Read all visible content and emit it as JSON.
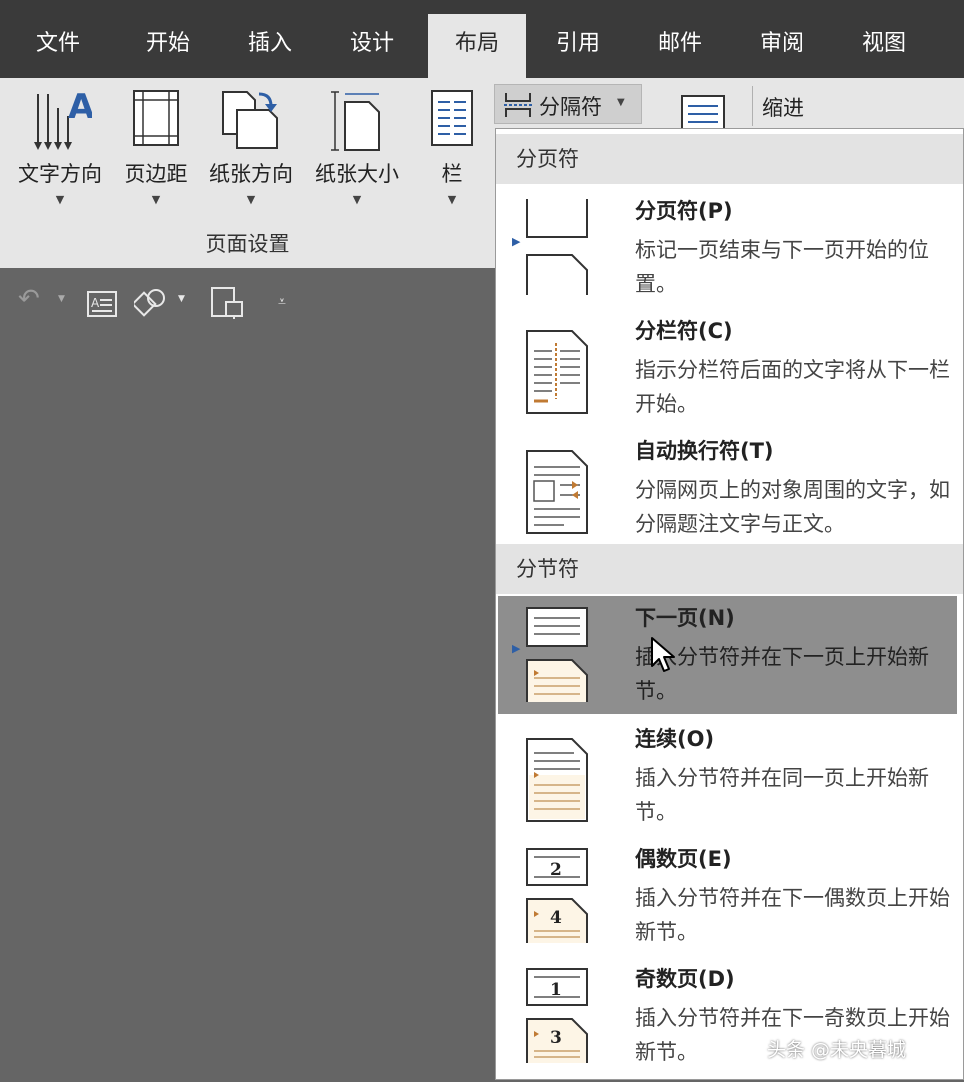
{
  "tabs": [
    {
      "label": "文件",
      "active": false
    },
    {
      "label": "开始",
      "active": false
    },
    {
      "label": "插入",
      "active": false
    },
    {
      "label": "设计",
      "active": false
    },
    {
      "label": "布局",
      "active": true
    },
    {
      "label": "引用",
      "active": false
    },
    {
      "label": "邮件",
      "active": false
    },
    {
      "label": "审阅",
      "active": false
    },
    {
      "label": "视图",
      "active": false
    }
  ],
  "ribbon": {
    "buttons": [
      {
        "label": "文字方向",
        "icon": "text-direction-icon"
      },
      {
        "label": "页边距",
        "icon": "margins-icon"
      },
      {
        "label": "纸张方向",
        "icon": "orientation-icon"
      },
      {
        "label": "纸张大小",
        "icon": "paper-size-icon"
      },
      {
        "label": "栏",
        "icon": "columns-icon"
      }
    ],
    "group_label": "页面设置",
    "breaks_button": "分隔符",
    "indent_label": "缩进"
  },
  "qat": [
    "undo-icon",
    "text-box-icon",
    "shapes-icon",
    "touch-mode-icon",
    "customize-icon"
  ],
  "menu": {
    "section1": "分页符",
    "section2": "分节符",
    "items": [
      {
        "title": "分页符(P)",
        "desc": "标记一页结束与下一页开始的位置。",
        "icon": "page-break-icon",
        "highlighted": false
      },
      {
        "title": "分栏符(C)",
        "desc": "指示分栏符后面的文字将从下一栏开始。",
        "icon": "column-break-icon",
        "highlighted": false
      },
      {
        "title": "自动换行符(T)",
        "desc": "分隔网页上的对象周围的文字，如分隔题注文字与正文。",
        "icon": "text-wrapping-break-icon",
        "highlighted": false
      },
      {
        "title": "下一页(N)",
        "desc": "插入分节符并在下一页上开始新节。",
        "icon": "next-page-break-icon",
        "highlighted": true
      },
      {
        "title": "连续(O)",
        "desc": "插入分节符并在同一页上开始新节。",
        "icon": "continuous-break-icon",
        "highlighted": false
      },
      {
        "title": "偶数页(E)",
        "desc": "插入分节符并在下一偶数页上开始新节。",
        "icon": "even-page-break-icon",
        "highlighted": false
      },
      {
        "title": "奇数页(D)",
        "desc": "插入分节符并在下一奇数页上开始新节。",
        "icon": "odd-page-break-icon",
        "highlighted": false
      }
    ]
  },
  "page_numbers": {
    "even": [
      "2",
      "4"
    ],
    "odd": [
      "1",
      "3"
    ]
  },
  "watermark": "头条 @未央暮城"
}
